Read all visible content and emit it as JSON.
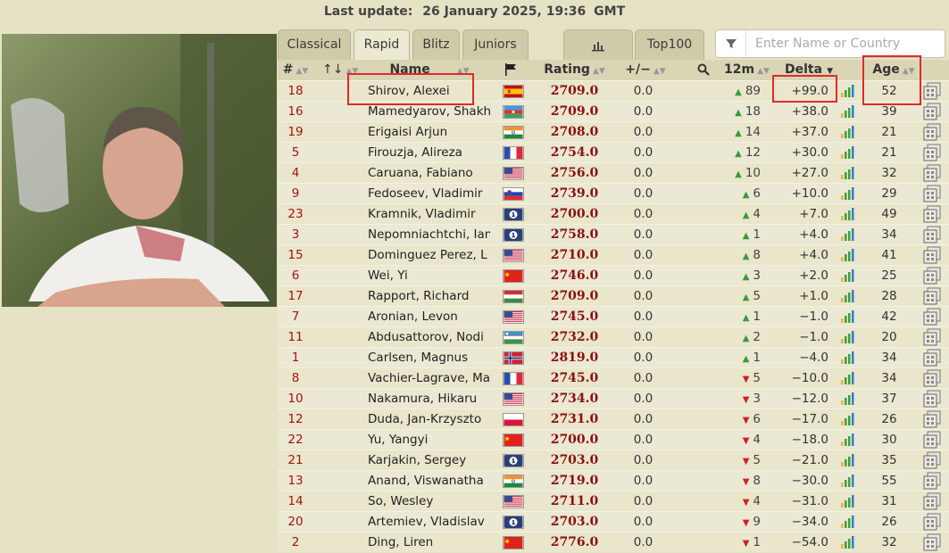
{
  "header": {
    "last_update_label": "Last update:",
    "last_update_value": "26 January 2025, 19:36",
    "timezone": "GMT"
  },
  "tabs": [
    {
      "label": "Classical"
    },
    {
      "label": "Rapid"
    },
    {
      "label": "Blitz"
    },
    {
      "label": "Juniors"
    },
    {
      "label": ""
    },
    {
      "label": "Top100"
    }
  ],
  "active_tab": "Rapid",
  "search": {
    "placeholder": "Enter Name or Country"
  },
  "columns": {
    "rank": "#",
    "sort": "↑↓",
    "name": "Name",
    "rating": "Rating",
    "plusminus": "+/−",
    "m12": "12m",
    "delta": "Delta",
    "age": "Age"
  },
  "rows": [
    {
      "rank": "18",
      "name": "Shirov, Alexei",
      "flag": "esp",
      "rating": "2709.0",
      "pm": "0.0",
      "trend": "up",
      "m12": "89",
      "delta": "+99.0",
      "age": "52"
    },
    {
      "rank": "16",
      "name": "Mamedyarov, Shakh",
      "flag": "aze",
      "rating": "2709.0",
      "pm": "0.0",
      "trend": "up",
      "m12": "18",
      "delta": "+38.0",
      "age": "39"
    },
    {
      "rank": "19",
      "name": "Erigaisi Arjun",
      "flag": "ind",
      "rating": "2708.0",
      "pm": "0.0",
      "trend": "up",
      "m12": "14",
      "delta": "+37.0",
      "age": "21"
    },
    {
      "rank": "5",
      "name": "Firouzja, Alireza",
      "flag": "fra",
      "rating": "2754.0",
      "pm": "0.0",
      "trend": "up",
      "m12": "12",
      "delta": "+30.0",
      "age": "21"
    },
    {
      "rank": "4",
      "name": "Caruana, Fabiano",
      "flag": "usa",
      "rating": "2756.0",
      "pm": "0.0",
      "trend": "up",
      "m12": "10",
      "delta": "+27.0",
      "age": "32"
    },
    {
      "rank": "9",
      "name": "Fedoseev, Vladimir",
      "flag": "slo",
      "rating": "2739.0",
      "pm": "0.0",
      "trend": "up",
      "m12": "6",
      "delta": "+10.0",
      "age": "29"
    },
    {
      "rank": "23",
      "name": "Kramnik, Vladimir",
      "flag": "fide",
      "rating": "2700.0",
      "pm": "0.0",
      "trend": "up",
      "m12": "4",
      "delta": "+7.0",
      "age": "49"
    },
    {
      "rank": "3",
      "name": "Nepomniachtchi, Ian",
      "flag": "fide",
      "rating": "2758.0",
      "pm": "0.0",
      "trend": "up",
      "m12": "1",
      "delta": "+4.0",
      "age": "34"
    },
    {
      "rank": "15",
      "name": "Dominguez Perez, L",
      "flag": "usa",
      "rating": "2710.0",
      "pm": "0.0",
      "trend": "up",
      "m12": "8",
      "delta": "+4.0",
      "age": "41"
    },
    {
      "rank": "6",
      "name": "Wei, Yi",
      "flag": "chn",
      "rating": "2746.0",
      "pm": "0.0",
      "trend": "up",
      "m12": "3",
      "delta": "+2.0",
      "age": "25"
    },
    {
      "rank": "17",
      "name": "Rapport, Richard",
      "flag": "hun",
      "rating": "2709.0",
      "pm": "0.0",
      "trend": "up",
      "m12": "5",
      "delta": "+1.0",
      "age": "28"
    },
    {
      "rank": "7",
      "name": "Aronian, Levon",
      "flag": "usa",
      "rating": "2745.0",
      "pm": "0.0",
      "trend": "up",
      "m12": "1",
      "delta": "−1.0",
      "age": "42"
    },
    {
      "rank": "11",
      "name": "Abdusattorov, Nodi",
      "flag": "uzb",
      "rating": "2732.0",
      "pm": "0.0",
      "trend": "up",
      "m12": "2",
      "delta": "−1.0",
      "age": "20"
    },
    {
      "rank": "1",
      "name": "Carlsen, Magnus",
      "flag": "nor",
      "rating": "2819.0",
      "pm": "0.0",
      "trend": "up",
      "m12": "1",
      "delta": "−4.0",
      "age": "34"
    },
    {
      "rank": "8",
      "name": "Vachier-Lagrave, Ma",
      "flag": "fra",
      "rating": "2745.0",
      "pm": "0.0",
      "trend": "down",
      "m12": "5",
      "delta": "−10.0",
      "age": "34"
    },
    {
      "rank": "10",
      "name": "Nakamura, Hikaru",
      "flag": "usa",
      "rating": "2734.0",
      "pm": "0.0",
      "trend": "down",
      "m12": "3",
      "delta": "−12.0",
      "age": "37"
    },
    {
      "rank": "12",
      "name": "Duda, Jan-Krzyszto",
      "flag": "pol",
      "rating": "2731.0",
      "pm": "0.0",
      "trend": "down",
      "m12": "6",
      "delta": "−17.0",
      "age": "26"
    },
    {
      "rank": "22",
      "name": "Yu, Yangyi",
      "flag": "chn",
      "rating": "2700.0",
      "pm": "0.0",
      "trend": "down",
      "m12": "4",
      "delta": "−18.0",
      "age": "30"
    },
    {
      "rank": "21",
      "name": "Karjakin, Sergey",
      "flag": "fide",
      "rating": "2703.0",
      "pm": "0.0",
      "trend": "down",
      "m12": "5",
      "delta": "−21.0",
      "age": "35"
    },
    {
      "rank": "13",
      "name": "Anand, Viswanatha",
      "flag": "ind",
      "rating": "2719.0",
      "pm": "0.0",
      "trend": "down",
      "m12": "8",
      "delta": "−30.0",
      "age": "55"
    },
    {
      "rank": "14",
      "name": "So, Wesley",
      "flag": "usa",
      "rating": "2711.0",
      "pm": "0.0",
      "trend": "down",
      "m12": "4",
      "delta": "−31.0",
      "age": "31"
    },
    {
      "rank": "20",
      "name": "Artemiev, Vladislav",
      "flag": "fide",
      "rating": "2703.0",
      "pm": "0.0",
      "trend": "down",
      "m12": "9",
      "delta": "−34.0",
      "age": "26"
    },
    {
      "rank": "2",
      "name": "Ding, Liren",
      "flag": "chn",
      "rating": "2776.0",
      "pm": "0.0",
      "trend": "down",
      "m12": "1",
      "delta": "−54.0",
      "age": "32"
    }
  ],
  "colors": {
    "accent_red": "#e0292b",
    "rating_red": "#8b1010",
    "up_green": "#3a9a3a",
    "down_red": "#c22222",
    "background": "#e6e2c6"
  }
}
